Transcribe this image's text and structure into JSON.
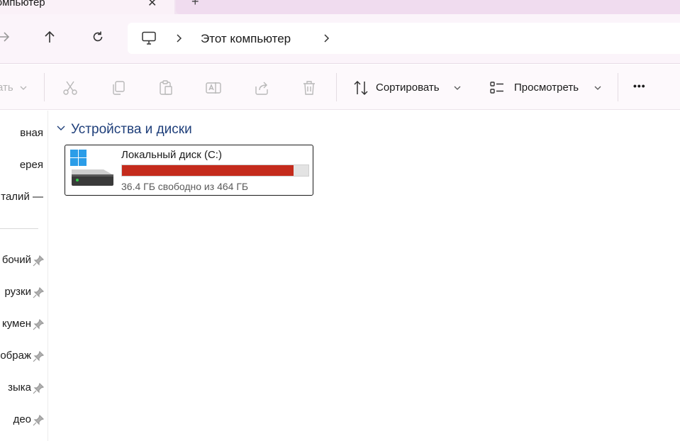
{
  "tab": {
    "title": "компьютер",
    "close_glyph": "✕",
    "new_glyph": "+"
  },
  "address": {
    "path": "Этот компьютер",
    "computer_icon": "monitor-icon"
  },
  "navigation": {
    "forward_icon": "arrow-right-icon",
    "up_icon": "arrow-up-icon",
    "refresh_icon": "refresh-icon"
  },
  "toolbar": {
    "create_label": "ать",
    "sort_label": "Сортировать",
    "view_label": "Просмотреть",
    "more_label": "•••"
  },
  "sidebar": {
    "items": [
      {
        "label": "вная",
        "pinned": false
      },
      {
        "label": "ерея",
        "pinned": false
      },
      {
        "label": "талий —",
        "pinned": false
      },
      {
        "label": "бочий",
        "pinned": true
      },
      {
        "label": "рузки",
        "pinned": true
      },
      {
        "label": "кумен",
        "pinned": true
      },
      {
        "label": "ображ",
        "pinned": true
      },
      {
        "label": "зыка",
        "pinned": true
      },
      {
        "label": "део",
        "pinned": true
      }
    ]
  },
  "content": {
    "group_title": "Устройства и диски",
    "drives": [
      {
        "name": "Локальный диск (C:)",
        "free_text": "36.4 ГБ свободно из 464 ГБ",
        "used_fraction": 0.92
      }
    ]
  },
  "colors": {
    "accent": "#1f3f7a",
    "usage_bar_full": "#c42b1c",
    "windows_logo": "#2b9de8"
  }
}
